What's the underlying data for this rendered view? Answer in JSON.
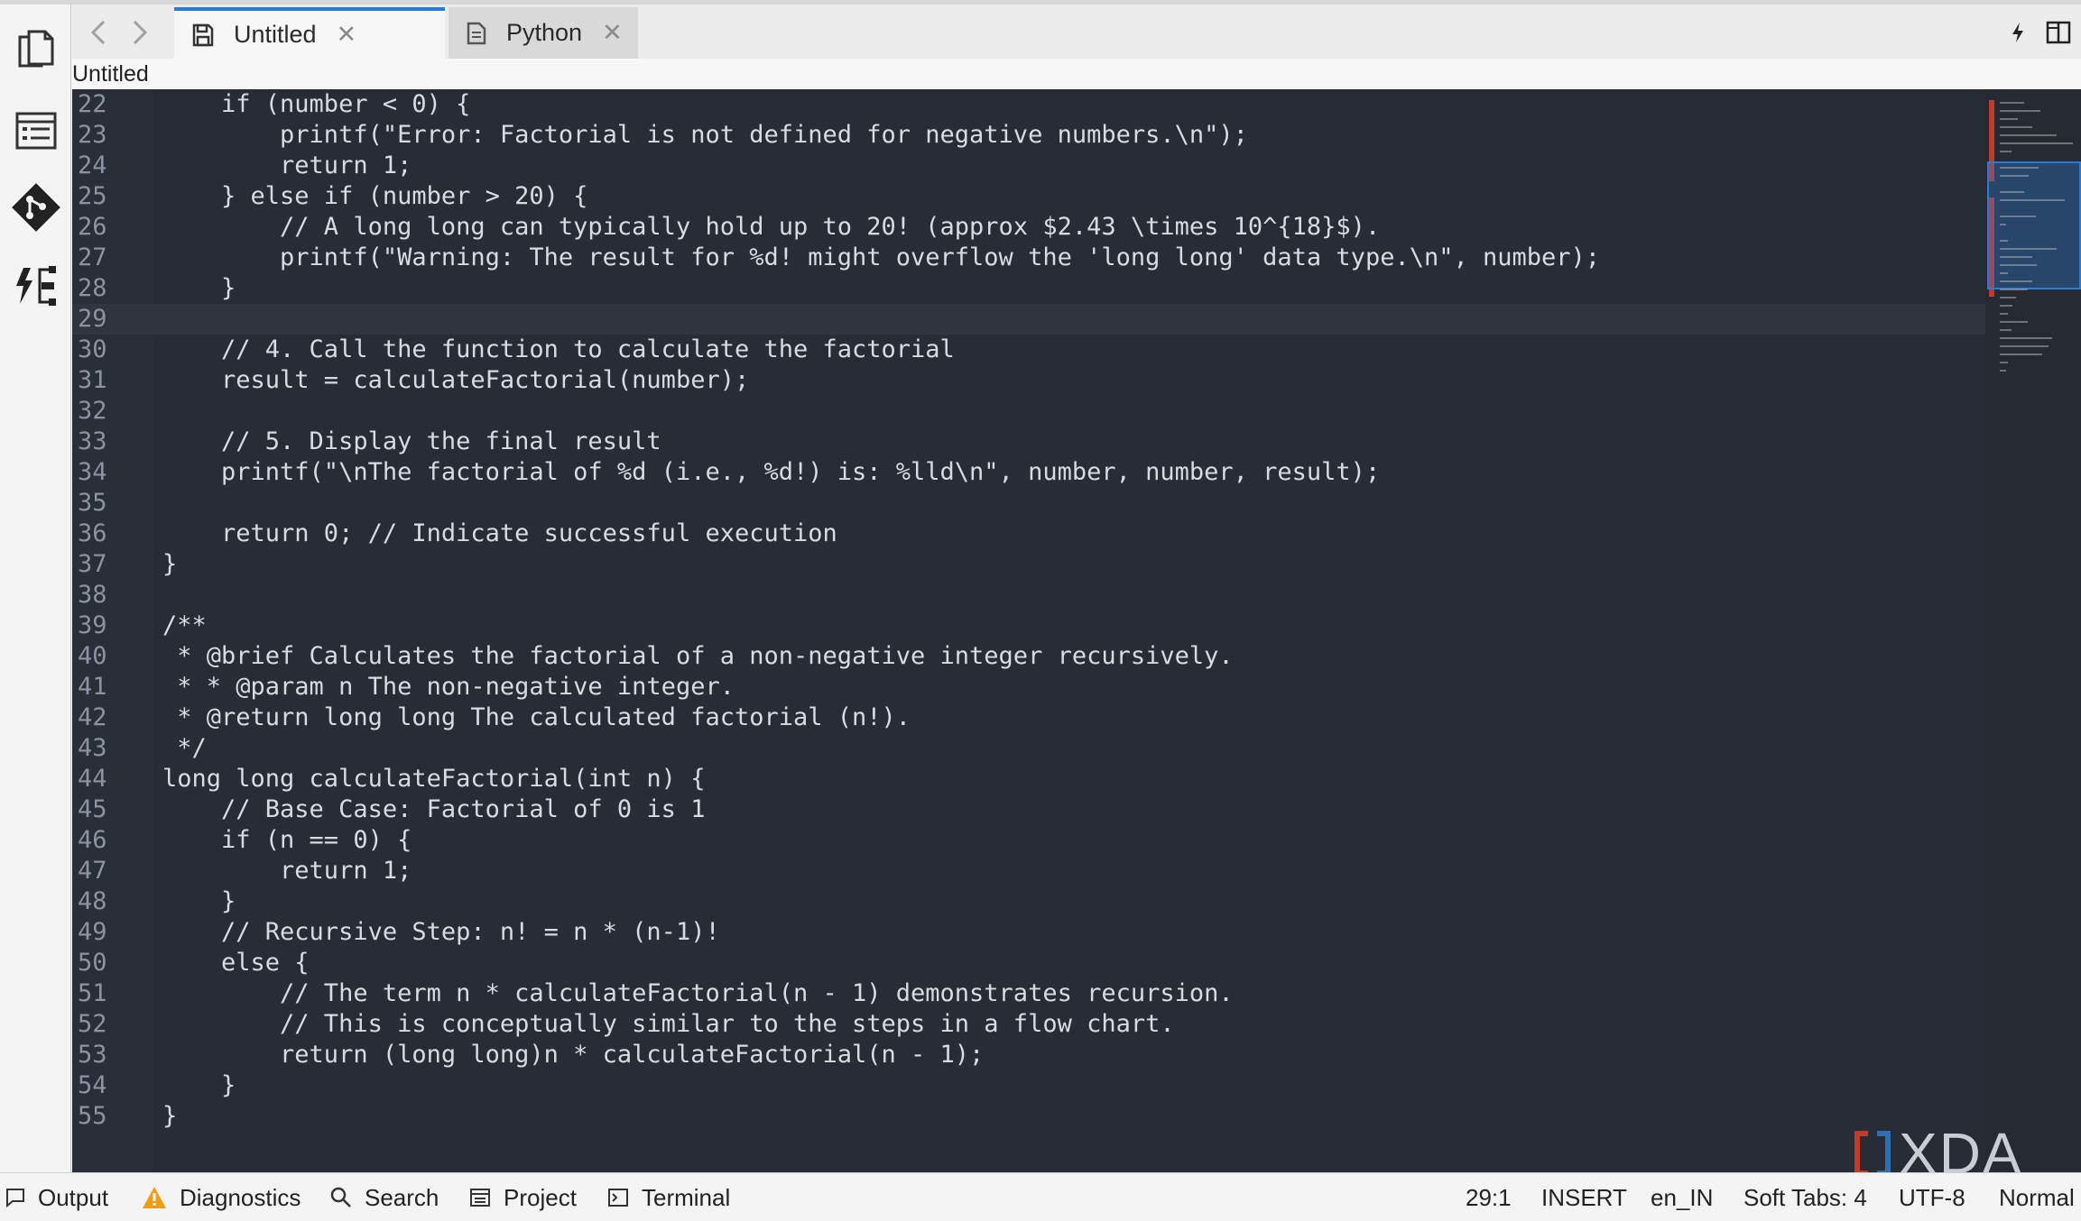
{
  "tabs": [
    {
      "label": "Untitled",
      "active": true
    },
    {
      "label": "Python",
      "active": false
    }
  ],
  "tab_close_glyph": "✕",
  "breadcrumb": "Untitled",
  "current_line": "29",
  "code_lines": [
    {
      "n": "22",
      "t": "    if (number < 0) {"
    },
    {
      "n": "23",
      "t": "        printf(\"Error: Factorial is not defined for negative numbers.\\n\");"
    },
    {
      "n": "24",
      "t": "        return 1;"
    },
    {
      "n": "25",
      "t": "    } else if (number > 20) {"
    },
    {
      "n": "26",
      "t": "        // A long long can typically hold up to 20! (approx $2.43 \\times 10^{18}$)."
    },
    {
      "n": "27",
      "t": "        printf(\"Warning: The result for %d! might overflow the 'long long' data type.\\n\", number);"
    },
    {
      "n": "28",
      "t": "    }"
    },
    {
      "n": "29",
      "t": ""
    },
    {
      "n": "30",
      "t": "    // 4. Call the function to calculate the factorial"
    },
    {
      "n": "31",
      "t": "    result = calculateFactorial(number);"
    },
    {
      "n": "32",
      "t": ""
    },
    {
      "n": "33",
      "t": "    // 5. Display the final result"
    },
    {
      "n": "34",
      "t": "    printf(\"\\nThe factorial of %d (i.e., %d!) is: %lld\\n\", number, number, result);"
    },
    {
      "n": "35",
      "t": ""
    },
    {
      "n": "36",
      "t": "    return 0; // Indicate successful execution"
    },
    {
      "n": "37",
      "t": "}"
    },
    {
      "n": "38",
      "t": ""
    },
    {
      "n": "39",
      "t": "/**"
    },
    {
      "n": "40",
      "t": " * @brief Calculates the factorial of a non-negative integer recursively."
    },
    {
      "n": "41",
      "t": " * * @param n The non-negative integer."
    },
    {
      "n": "42",
      "t": " * @return long long The calculated factorial (n!)."
    },
    {
      "n": "43",
      "t": " */"
    },
    {
      "n": "44",
      "t": "long long calculateFactorial(int n) {"
    },
    {
      "n": "45",
      "t": "    // Base Case: Factorial of 0 is 1"
    },
    {
      "n": "46",
      "t": "    if (n == 0) {"
    },
    {
      "n": "47",
      "t": "        return 1;"
    },
    {
      "n": "48",
      "t": "    }"
    },
    {
      "n": "49",
      "t": "    // Recursive Step: n! = n * (n-1)!"
    },
    {
      "n": "50",
      "t": "    else {"
    },
    {
      "n": "51",
      "t": "        // The term n * calculateFactorial(n - 1) demonstrates recursion."
    },
    {
      "n": "52",
      "t": "        // This is conceptually similar to the steps in a flow chart."
    },
    {
      "n": "53",
      "t": "        return (long long)n * calculateFactorial(n - 1);"
    },
    {
      "n": "54",
      "t": "    }"
    },
    {
      "n": "55",
      "t": "}"
    }
  ],
  "status": {
    "output": "Output",
    "diagnostics": "Diagnostics",
    "search": "Search",
    "project": "Project",
    "terminal": "Terminal",
    "cursor": "29:1",
    "mode": "INSERT",
    "language": "en_IN",
    "indent": "Soft Tabs: 4",
    "encoding": "UTF-8",
    "view": "Normal"
  },
  "watermark": "XDA",
  "colors": {
    "accent": "#2b7bd3",
    "editor_bg": "#282c34",
    "warning": "#f39c12"
  },
  "icons": {
    "activity": [
      "files-icon",
      "outline-icon",
      "git-icon",
      "flow-icon"
    ],
    "nav": [
      "chevron-left-icon",
      "chevron-right-icon"
    ],
    "tab_untitled": "save-icon",
    "tab_python": "document-icon",
    "topright": [
      "lightning-icon",
      "split-view-icon"
    ]
  }
}
